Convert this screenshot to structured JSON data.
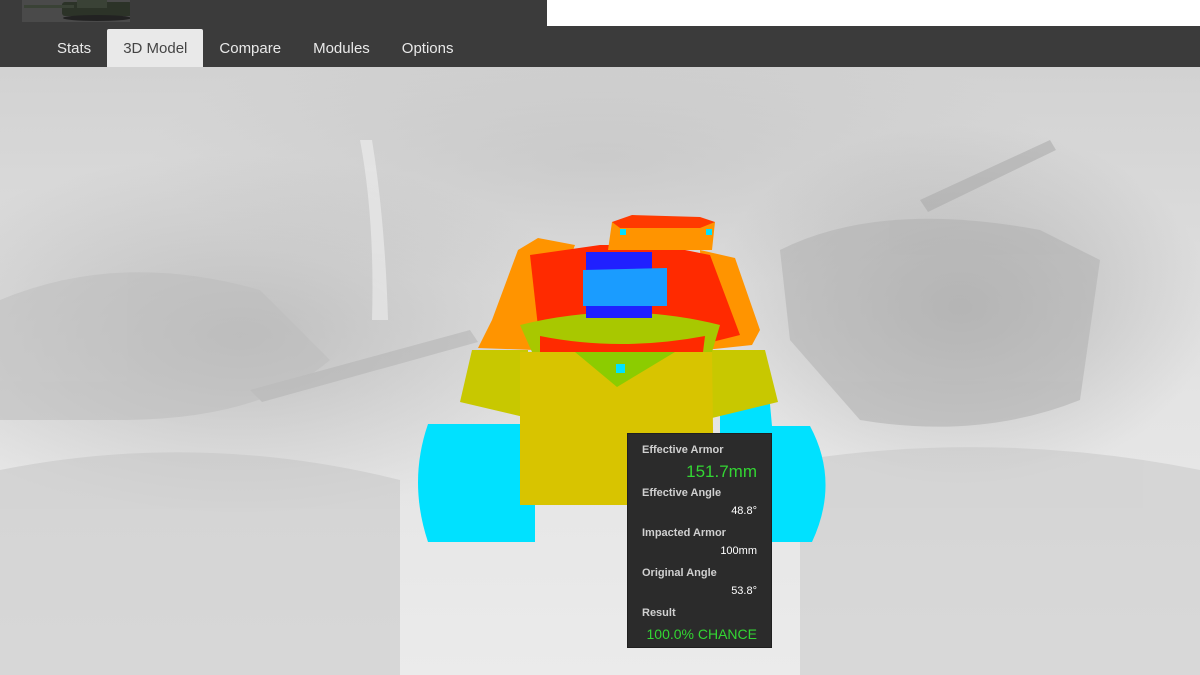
{
  "header": {
    "tabs": [
      {
        "label": "Stats",
        "active": false
      },
      {
        "label": "3D Model",
        "active": true
      },
      {
        "label": "Compare",
        "active": false
      },
      {
        "label": "Modules",
        "active": false
      },
      {
        "label": "Options",
        "active": false
      }
    ],
    "search": {
      "value": "",
      "placeholder": ""
    }
  },
  "tooltip": {
    "effective_armor_label": "Effective Armor",
    "effective_armor_value": "151.7mm",
    "effective_angle_label": "Effective Angle",
    "effective_angle_value": "48.8°",
    "impacted_armor_label": "Impacted Armor",
    "impacted_armor_value": "100mm",
    "original_angle_label": "Original Angle",
    "original_angle_value": "53.8°",
    "result_label": "Result",
    "result_value": "100.0% CHANCE"
  },
  "colors": {
    "armor_max": "#ff2a00",
    "armor_high": "#ff8c00",
    "armor_mid": "#a8c800",
    "armor_low": "#d8c400",
    "armor_non_penetrable": "#1a1aff",
    "tracks": "#00e1ff",
    "result_good": "#33d633"
  }
}
